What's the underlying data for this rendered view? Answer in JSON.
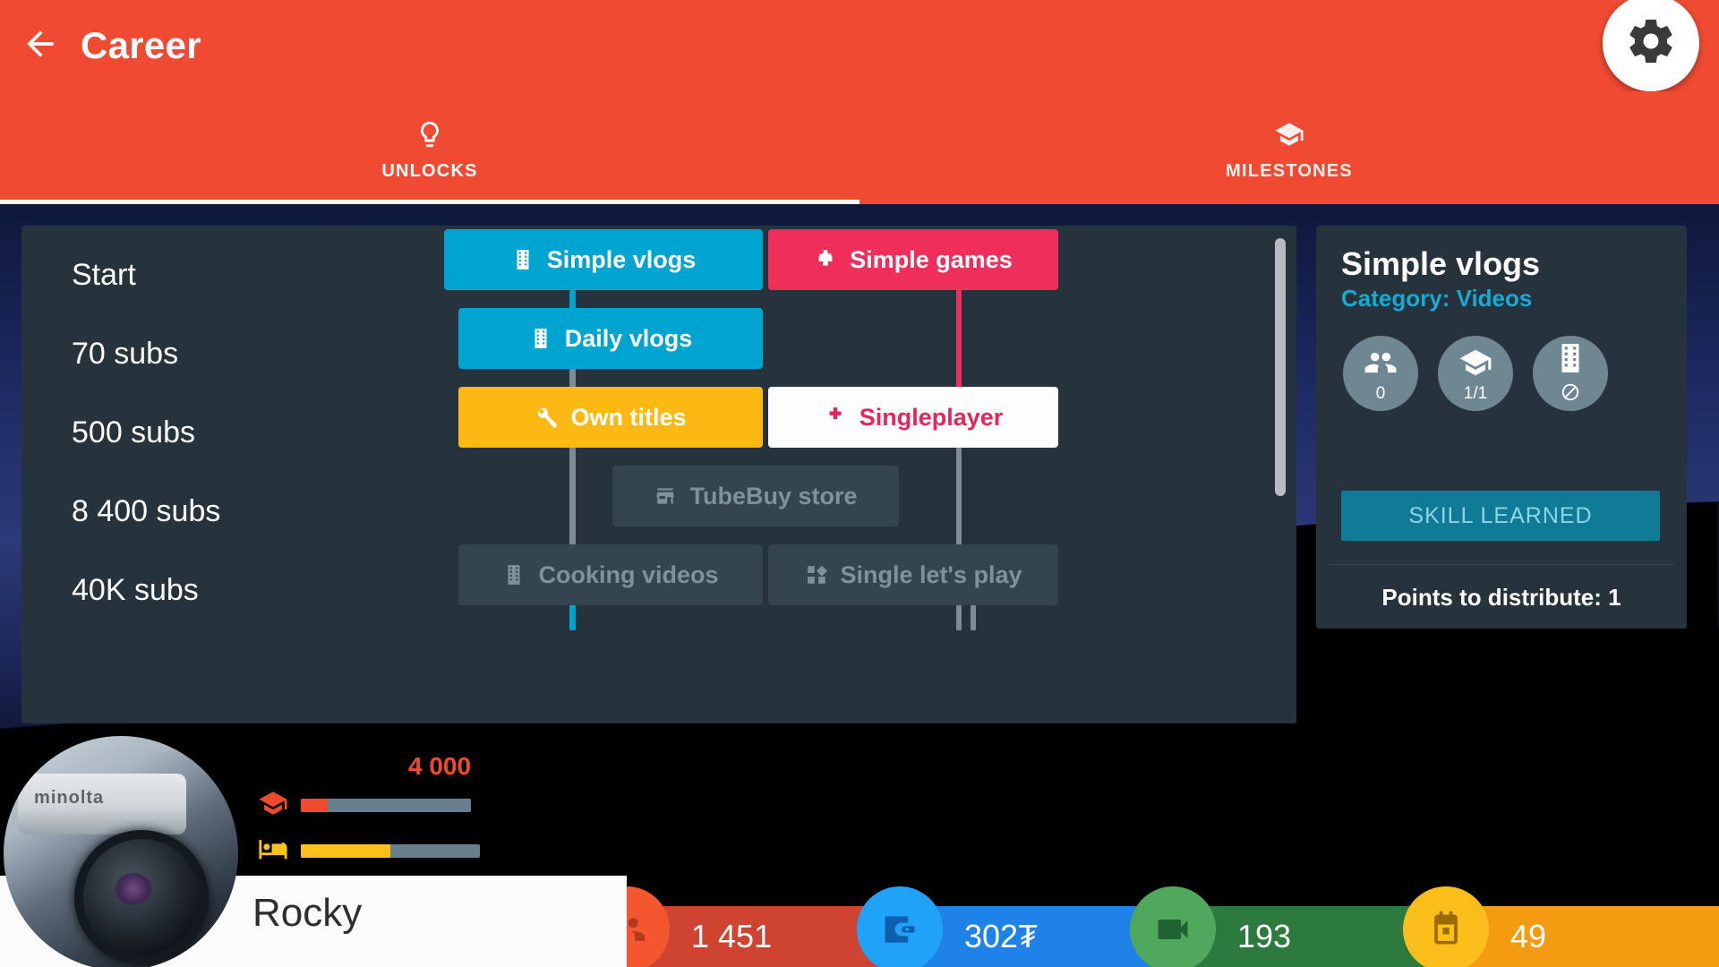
{
  "appbar": {
    "title": "Career",
    "back_icon": "arrow-left-icon",
    "settings_icon": "gear-icon"
  },
  "tabs": [
    {
      "label": "UNLOCKS",
      "icon": "lightbulb-icon",
      "active": true
    },
    {
      "label": "MILESTONES",
      "icon": "graduation-cap-icon",
      "active": false
    }
  ],
  "tree": {
    "tiers": [
      {
        "label": "Start"
      },
      {
        "label": "70 subs"
      },
      {
        "label": "500 subs"
      },
      {
        "label": "8 400 subs"
      },
      {
        "label": "40K subs"
      }
    ],
    "nodes": [
      {
        "label": "Simple vlogs",
        "icon": "film-strip-icon",
        "state": "unlocked-video",
        "color": "#00a4d0"
      },
      {
        "label": "Simple games",
        "icon": "gamepad-icon",
        "state": "unlocked-game",
        "color": "#ef2e5b"
      },
      {
        "label": "Daily vlogs",
        "icon": "film-strip-icon",
        "state": "unlocked-video",
        "color": "#00a4d0"
      },
      {
        "label": "Own titles",
        "icon": "wrench-icon",
        "state": "unlocked-tool",
        "color": "#fcb813"
      },
      {
        "label": "Singleplayer",
        "icon": "gamepad-icon",
        "state": "available",
        "color": "#fdfdfd"
      },
      {
        "label": "TubeBuy store",
        "icon": "store-icon",
        "state": "locked",
        "color": "#34454f"
      },
      {
        "label": "Cooking videos",
        "icon": "film-strip-icon",
        "state": "locked",
        "color": "#34454f"
      },
      {
        "label": "Single let's play",
        "icon": "blocks-icon",
        "state": "locked",
        "color": "#34454f"
      }
    ],
    "scrollbar": "vertical-scrollbar"
  },
  "info_panel": {
    "title": "Simple vlogs",
    "category": "Category: Videos",
    "badges": [
      {
        "icon": "people-icon",
        "value": "0"
      },
      {
        "icon": "graduation-cap-icon",
        "value": "1/1"
      },
      {
        "icon": "film-strip-icon",
        "value": "",
        "overlay": "blocked-icon"
      }
    ],
    "skill_button": "SKILL LEARNED",
    "points_text": "Points to distribute: 1"
  },
  "player": {
    "avatar": "camera-avatar",
    "name": "Rocky",
    "bars": [
      {
        "icon": "graduation-cap-icon",
        "value": "4 000",
        "fill_pct": 16,
        "color": "#f0492e"
      },
      {
        "icon": "bed-icon",
        "value": "",
        "fill_pct": 50,
        "color": "#fcc21b"
      }
    ]
  },
  "stats": [
    {
      "icon": "people-icon",
      "value": "1 451",
      "bar_color": "#cf4430",
      "icon_color": "#f4572f",
      "glyph_color": "#b5381f"
    },
    {
      "icon": "wallet-icon",
      "value": "302₮",
      "bar_color": "#1f82e8",
      "icon_color": "#1fa2f7",
      "glyph_color": "#0c5fae"
    },
    {
      "icon": "video-camera-icon",
      "value": "193",
      "bar_color": "#2c7a3e",
      "icon_color": "#4fa85c",
      "glyph_color": "#1f6330"
    },
    {
      "icon": "calendar-icon",
      "value": "49",
      "bar_color": "#f59b12",
      "icon_color": "#fcbe1b",
      "glyph_color": "#9a6a06"
    }
  ],
  "colors": {
    "accent_red": "#f04a32",
    "card_bg": "#27333c",
    "cyan": "#00a4d0",
    "pink": "#ef2e5b",
    "yellow": "#fcb813",
    "locked": "#34454f"
  }
}
